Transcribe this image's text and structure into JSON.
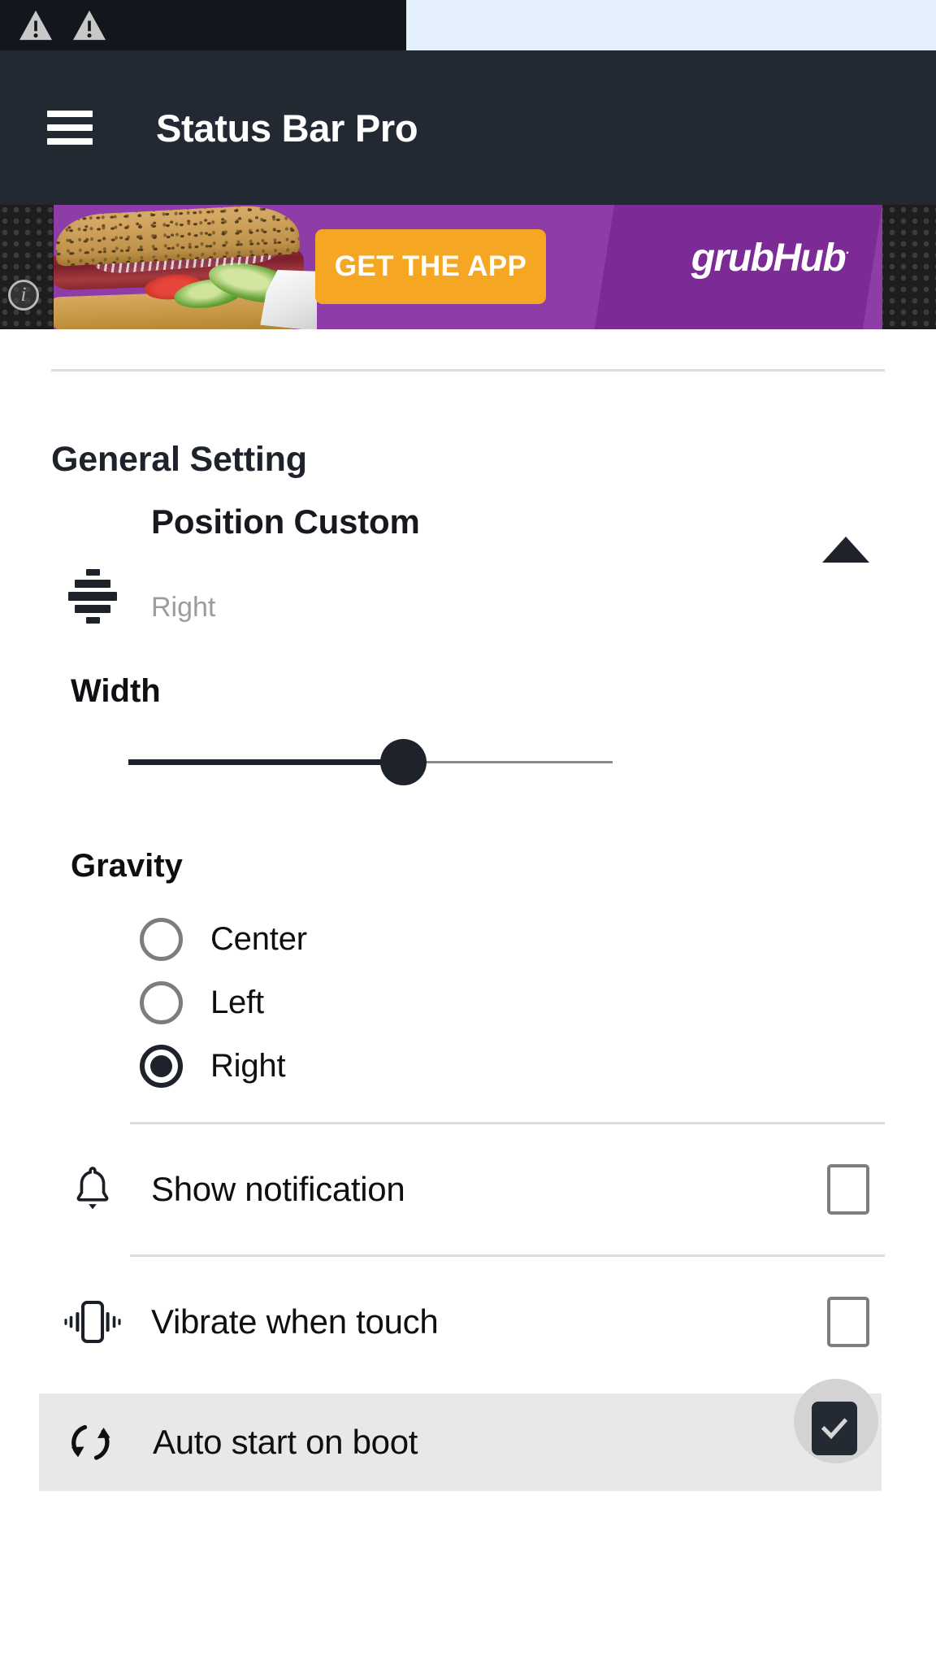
{
  "statusbar": {
    "icons": [
      "warning-triangle-icon",
      "warning-triangle-icon"
    ]
  },
  "appbar": {
    "menu_icon": "hamburger-menu-icon",
    "title": "Status Bar Pro"
  },
  "ad": {
    "cta_label": "GET THE APP",
    "brand": "grubHub",
    "brand_mark": "·",
    "info_label": "i",
    "colors": {
      "purple_light": "#8e3da8",
      "purple_dark": "#7c2b96",
      "cta_orange": "#f5a623"
    }
  },
  "main": {
    "section_title": "General Setting",
    "position": {
      "icon": "align-vertical-center-icon",
      "title": "Position Custom",
      "value": "Right",
      "expander_icon": "triangle-up-icon"
    },
    "width": {
      "label": "Width",
      "value_percent": 57,
      "min": 0,
      "max": 100
    },
    "gravity": {
      "label": "Gravity",
      "options": [
        {
          "label": "Center",
          "selected": false
        },
        {
          "label": "Left",
          "selected": false
        },
        {
          "label": "Right",
          "selected": true
        }
      ]
    },
    "toggles": [
      {
        "icon": "bell-icon",
        "label": "Show notification",
        "checked": false
      },
      {
        "icon": "vibrate-icon",
        "label": "Vibrate when touch",
        "checked": false
      },
      {
        "icon": "auto-restart-icon",
        "label": "Auto start on boot",
        "checked": true
      }
    ]
  }
}
